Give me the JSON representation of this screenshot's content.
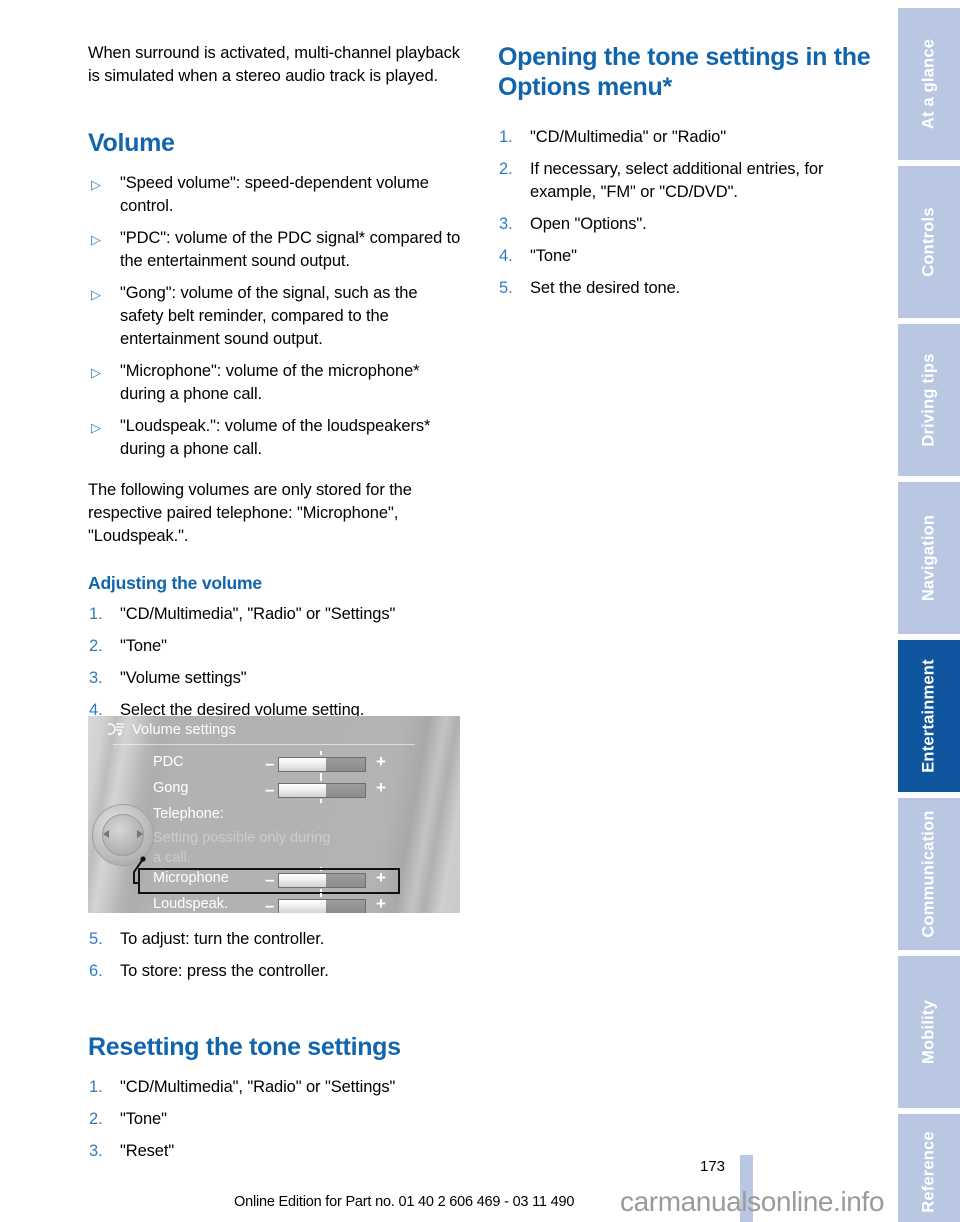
{
  "left_column": {
    "intro_paragraph": "When surround is activated, multi-channel playback is simulated when a stereo audio track is played.",
    "volume_heading": "Volume",
    "volume_bullets": [
      "\"Speed volume\": speed-dependent volume control.",
      "\"PDC\": volume of the PDC signal* compared to the entertainment sound output.",
      "\"Gong\": volume of the signal, such as the safety belt reminder, compared to the entertainment sound output.",
      "\"Microphone\": volume of the microphone* during a phone call.",
      "\"Loudspeak.\": volume of the loudspeakers* during a phone call."
    ],
    "storage_note": "The following volumes are only stored for the respective paired telephone: \"Microphone\", \"Loudspeak.\".",
    "adjusting_heading": "Adjusting the volume",
    "adjusting_steps": [
      "\"CD/Multimedia\", \"Radio\" or \"Settings\"",
      "\"Tone\"",
      "\"Volume settings\"",
      "Select the desired volume setting."
    ],
    "adjusting_steps_after": [
      "To adjust: turn the controller.",
      "To store: press the controller."
    ],
    "resetting_heading": "Resetting the tone settings",
    "resetting_steps": [
      "\"CD/Multimedia\", \"Radio\" or \"Settings\"",
      "\"Tone\"",
      "\"Reset\""
    ]
  },
  "right_column": {
    "options_heading": "Opening the tone settings in the Options menu*",
    "options_steps": [
      "\"CD/Multimedia\" or \"Radio\"",
      "If necessary, select additional entries, for example, \"FM\" or \"CD/DVD\".",
      "Open \"Options\".",
      "\"Tone\"",
      "Set the desired tone."
    ]
  },
  "figure": {
    "title": "Volume settings",
    "title_icon": "music-note-icon",
    "rows": [
      {
        "label": "PDC",
        "has_slider": true,
        "dim": false
      },
      {
        "label": "Gong",
        "has_slider": true,
        "dim": false
      },
      {
        "label": "Telephone:",
        "has_slider": false,
        "dim": false
      },
      {
        "label": "Setting possible only during",
        "has_slider": false,
        "dim": true
      },
      {
        "label": "a call.",
        "has_slider": false,
        "dim": true
      },
      {
        "label": "Microphone",
        "has_slider": true,
        "dim": false
      },
      {
        "label": "Loudspeak.",
        "has_slider": true,
        "dim": false
      }
    ],
    "highlighted_row": "Microphone",
    "controller_icon": "idrive-controller-icon"
  },
  "tabs": [
    {
      "label": "At a glance",
      "active": false
    },
    {
      "label": "Controls",
      "active": false
    },
    {
      "label": "Driving tips",
      "active": false
    },
    {
      "label": "Navigation",
      "active": false
    },
    {
      "label": "Entertainment",
      "active": true
    },
    {
      "label": "Communication",
      "active": false
    },
    {
      "label": "Mobility",
      "active": false
    },
    {
      "label": "Reference",
      "active": false
    }
  ],
  "footer": {
    "page_number": "173",
    "edition_line": "Online Edition for Part no. 01 40 2 606 469 - 03 11 490",
    "watermark": "carmanualsonline.info"
  },
  "colors": {
    "heading_blue": "#1165ad",
    "accent_blue": "#2f7cc0",
    "tab_inactive": "#b9c7e2",
    "tab_active": "#10569f"
  }
}
